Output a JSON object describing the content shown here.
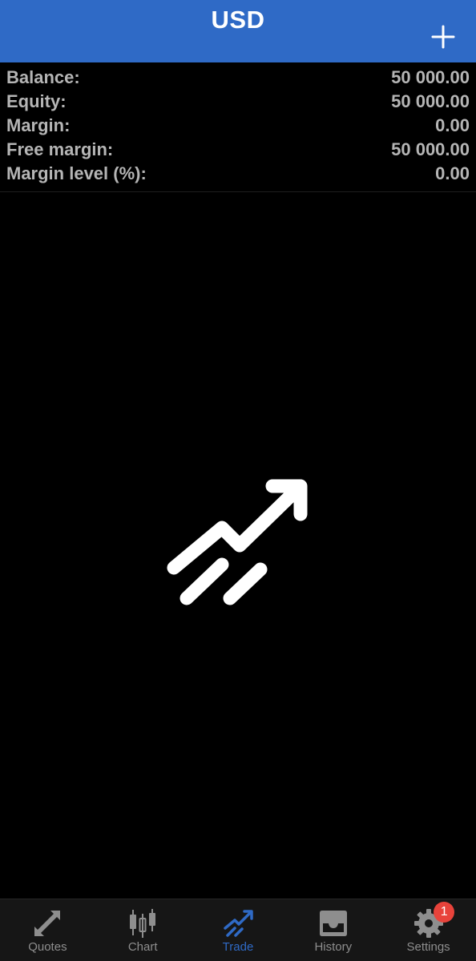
{
  "header": {
    "title": "USD",
    "add_icon": "plus-icon"
  },
  "account": {
    "rows": [
      {
        "label": "Balance:",
        "value": "50 000.00"
      },
      {
        "label": "Equity:",
        "value": "50 000.00"
      },
      {
        "label": "Margin:",
        "value": "0.00"
      },
      {
        "label": "Free margin:",
        "value": "50 000.00"
      },
      {
        "label": "Margin level (%):",
        "value": "0.00"
      }
    ]
  },
  "empty_state": {
    "icon": "trade-trend-arrow-icon"
  },
  "tabbar": {
    "active": "Trade",
    "tabs": [
      {
        "label": "Quotes",
        "icon": "quotes-arrows-icon"
      },
      {
        "label": "Chart",
        "icon": "candlestick-chart-icon"
      },
      {
        "label": "Trade",
        "icon": "trade-trend-icon"
      },
      {
        "label": "History",
        "icon": "inbox-tray-icon"
      },
      {
        "label": "Settings",
        "icon": "gear-icon",
        "badge": "1"
      }
    ]
  },
  "colors": {
    "header_bg": "#2f6ac6",
    "accent": "#2f6ac6",
    "background": "#000000",
    "text_secondary": "#b5b5b5",
    "tab_inactive": "#8e8e8e",
    "badge": "#e8433b"
  }
}
